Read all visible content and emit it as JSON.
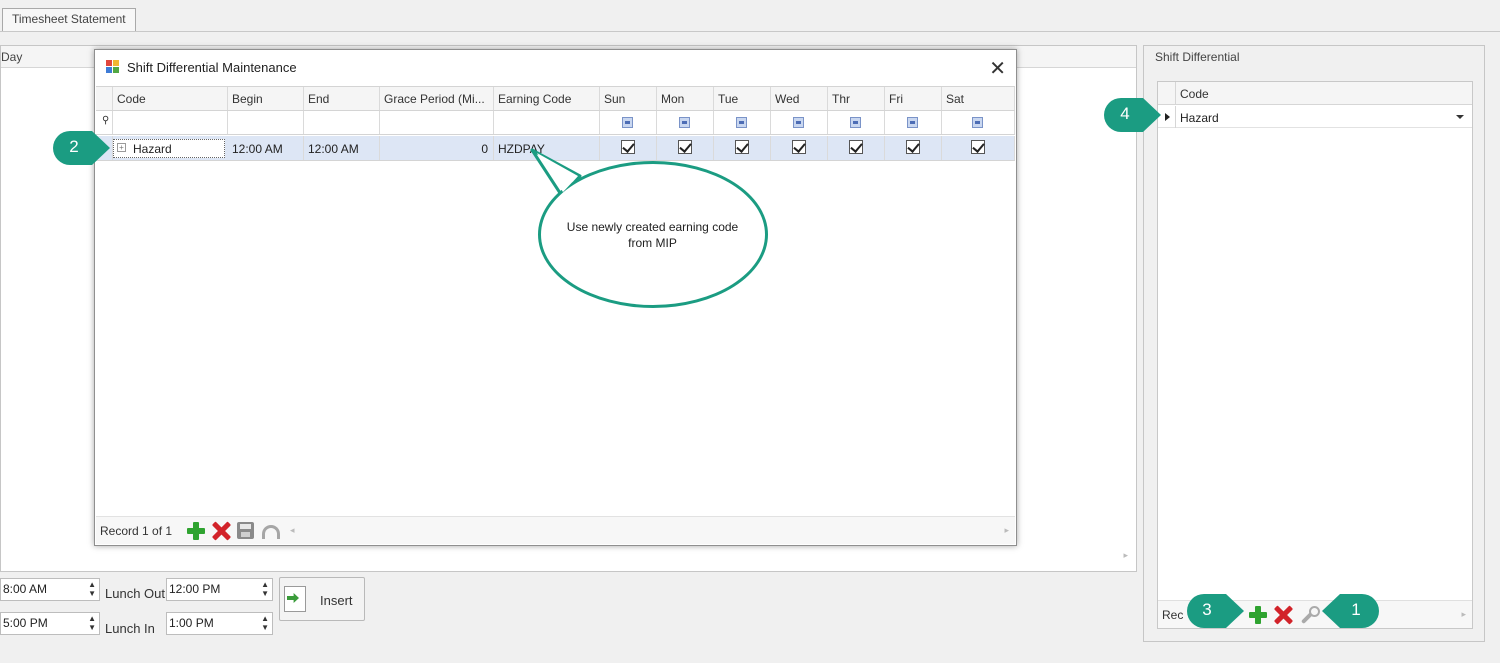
{
  "tabs": [
    {
      "label": "Timesheet Statement"
    }
  ],
  "background_grid": {
    "column_label": "Day"
  },
  "time_fields": {
    "in_time": "8:00 AM",
    "out_time": "5:00 PM",
    "lunch_out_label": "Lunch Out",
    "lunch_out_value": "12:00 PM",
    "lunch_in_label": "Lunch In",
    "lunch_in_value": "1:00 PM",
    "insert_label": "Insert"
  },
  "right_panel": {
    "title": "Shift Differential",
    "column": "Code",
    "row_value": "Hazard",
    "nav_text": "Rec"
  },
  "dialog": {
    "title": "Shift Differential Maintenance",
    "close_glyph": "✕",
    "columns": [
      "Code",
      "Begin",
      "End",
      "Grace Period (Mi...",
      "Earning Code",
      "Sun",
      "Mon",
      "Tue",
      "Wed",
      "Thr",
      "Fri",
      "Sat"
    ],
    "row": {
      "code": "Hazard",
      "begin": "12:00 AM",
      "end": "12:00 AM",
      "grace_period": "0",
      "earning_code": "HZDPAY",
      "days_checked": [
        true,
        true,
        true,
        true,
        true,
        true,
        true
      ]
    },
    "nav_text": "Record 1 of 1"
  },
  "annotation": {
    "bubble_text": "Use newly created earning code from MIP",
    "color": "#1b9c82"
  },
  "callouts": [
    {
      "label": "1"
    },
    {
      "label": "2"
    },
    {
      "label": "3"
    },
    {
      "label": "4"
    }
  ],
  "icons": [
    "app-icon",
    "close-icon",
    "add-icon",
    "delete-icon",
    "save-icon",
    "undo-icon",
    "wrench-icon",
    "insert-icon",
    "filter-pin-icon"
  ]
}
